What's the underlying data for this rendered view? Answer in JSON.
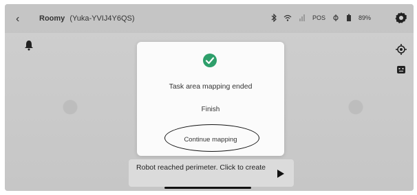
{
  "topbar": {
    "back_icon": "chevron-left-icon",
    "robot_name": "Roomy",
    "robot_id": "(Yuka-YVIJ4Y6QS)",
    "status": {
      "bluetooth_icon": "bluetooth-icon",
      "wifi_icon": "wifi-icon",
      "signal_icon": "signal-icon",
      "rtk_label": "POS",
      "satellite_icon": "satellite-icon",
      "battery_icon": "battery-icon",
      "battery_percent": "89%"
    },
    "settings_icon": "gear-icon"
  },
  "map": {
    "bell_icon": "bell-icon",
    "locate_icon": "crosshair-icon",
    "robot_icon": "robot-icon"
  },
  "dialog": {
    "icon": "check-circle-icon",
    "accent": "#1f9c8a",
    "title": "Task area mapping ended",
    "finish_label": "Finish",
    "continue_label": "Continue mapping"
  },
  "toast": {
    "message": "Robot reached perimeter. Click to create",
    "play_icon": "play-icon"
  }
}
